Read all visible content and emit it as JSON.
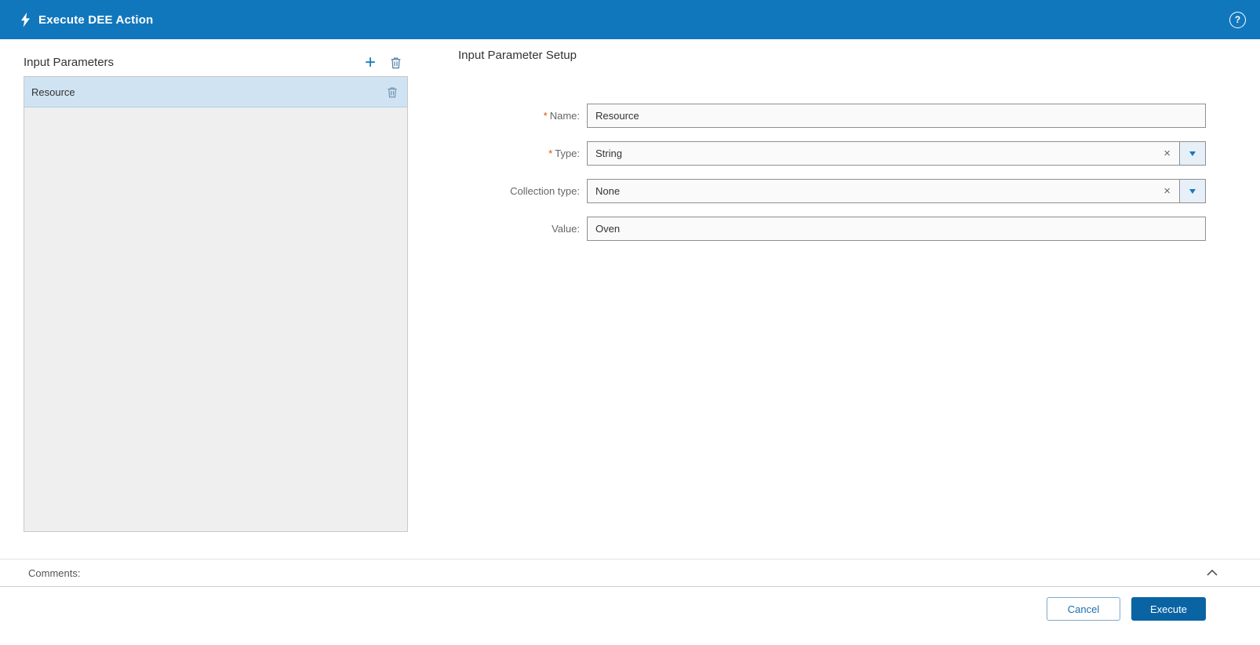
{
  "window": {
    "title": "Execute DEE Action"
  },
  "icons": {
    "help_glyph": "?",
    "add_glyph": "+",
    "clear_glyph": "×",
    "required_marker": "*"
  },
  "left_panel": {
    "title": "Input Parameters",
    "items": [
      {
        "label": "Resource",
        "selected": true
      }
    ]
  },
  "right_panel": {
    "title": "Input Parameter Setup",
    "fields": {
      "name": {
        "label": "Name:",
        "required": true,
        "value": "Resource"
      },
      "type": {
        "label": "Type:",
        "required": true,
        "value": "String",
        "control": "dropdown"
      },
      "collection_type": {
        "label": "Collection type:",
        "required": false,
        "value": "None",
        "control": "dropdown"
      },
      "value": {
        "label": "Value:",
        "required": false,
        "value": "Oven"
      }
    }
  },
  "comments": {
    "label": "Comments:"
  },
  "footer": {
    "cancel": "Cancel",
    "execute": "Execute"
  },
  "colors": {
    "header_bg": "#1177bd",
    "accent": "#1779ba",
    "selected_row_bg": "#cfe3f2",
    "execute_bg": "#0a64a4",
    "required": "#d35400"
  }
}
